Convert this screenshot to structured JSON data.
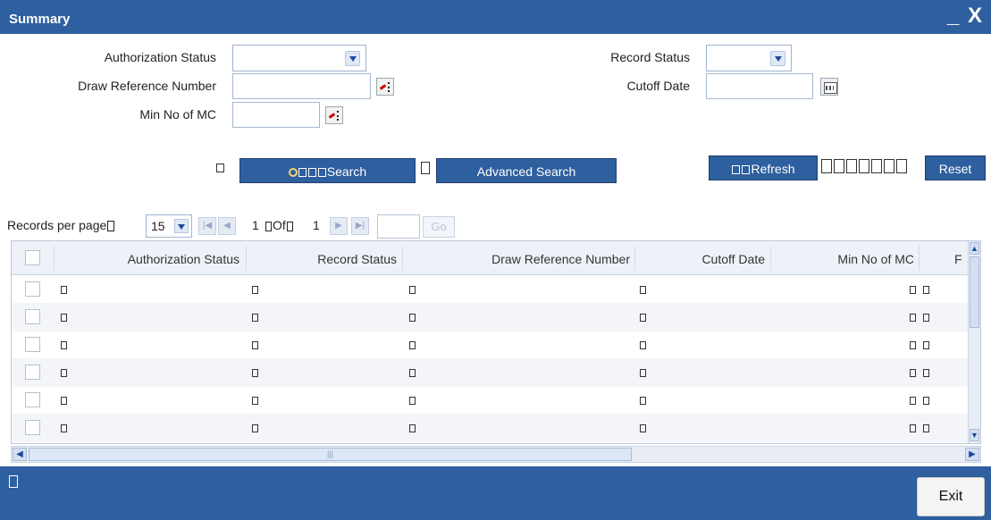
{
  "window": {
    "title": "Summary",
    "minimize": "_",
    "close": "X"
  },
  "form": {
    "authorization_status": {
      "label": "Authorization Status",
      "value": ""
    },
    "record_status": {
      "label": "Record Status",
      "value": ""
    },
    "draw_reference_number": {
      "label": "Draw Reference Number",
      "value": ""
    },
    "cutoff_date": {
      "label": "Cutoff Date",
      "value": ""
    },
    "min_no_of_mc": {
      "label": "Min No of MC",
      "value": ""
    }
  },
  "buttons": {
    "search": "Search",
    "advanced_search": "Advanced Search",
    "refresh": "Refresh",
    "reset": "Reset",
    "exit": "Exit"
  },
  "pager": {
    "records_per_page_label": "Records per page",
    "records_per_page": "15",
    "current_page": "1",
    "of_label": "Of",
    "total_pages": "1",
    "go_label": "Go"
  },
  "grid": {
    "columns": [
      "Authorization Status",
      "Record Status",
      "Draw Reference Number",
      "Cutoff Date",
      "Min No of MC",
      "F"
    ],
    "row_count": 7
  },
  "icons": {
    "dropdown": "chevron-down-icon",
    "lov": "lov-icon",
    "calendar": "calendar-icon",
    "search": "magnifier-icon"
  },
  "colors": {
    "header_blue": "#2e5f9e",
    "grid_header": "#eef2f8",
    "row_alt": "#f3f5f9"
  }
}
